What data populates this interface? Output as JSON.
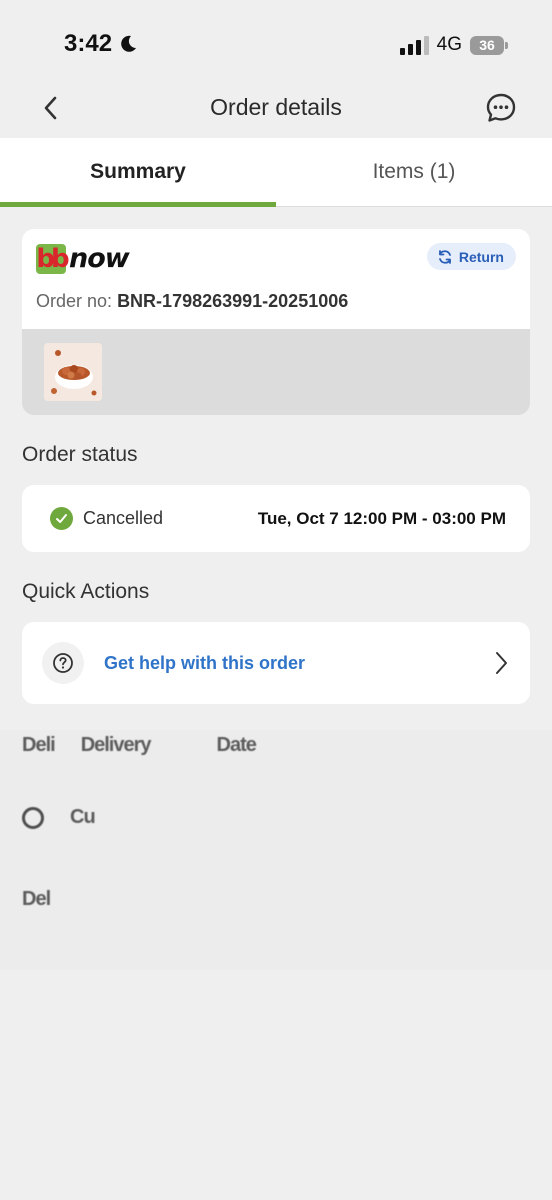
{
  "status_bar": {
    "time": "3:42",
    "network": "4G",
    "battery": "36"
  },
  "header": {
    "title": "Order details"
  },
  "tabs": [
    {
      "label": "Summary"
    },
    {
      "label": "Items (1)"
    }
  ],
  "order_card": {
    "brand_bb": "bb",
    "brand_now": "now",
    "return_label": "Return",
    "order_no_label": "Order no:",
    "order_no_value": "BNR-1798263991-20251006"
  },
  "order_status": {
    "section_title": "Order status",
    "status": "Cancelled",
    "slot": "Tue, Oct 7 12:00 PM - 03:00 PM"
  },
  "quick_actions": {
    "section_title": "Quick Actions",
    "help_label": "Get help with this order"
  },
  "blurred": {
    "row1": [
      "Deli",
      "Delivery",
      "Date"
    ],
    "row2": "Cu",
    "row3": "Del"
  },
  "colors": {
    "accent_green": "#6fa83c",
    "link_blue": "#2f74c8",
    "return_bg": "#e6eefb"
  }
}
